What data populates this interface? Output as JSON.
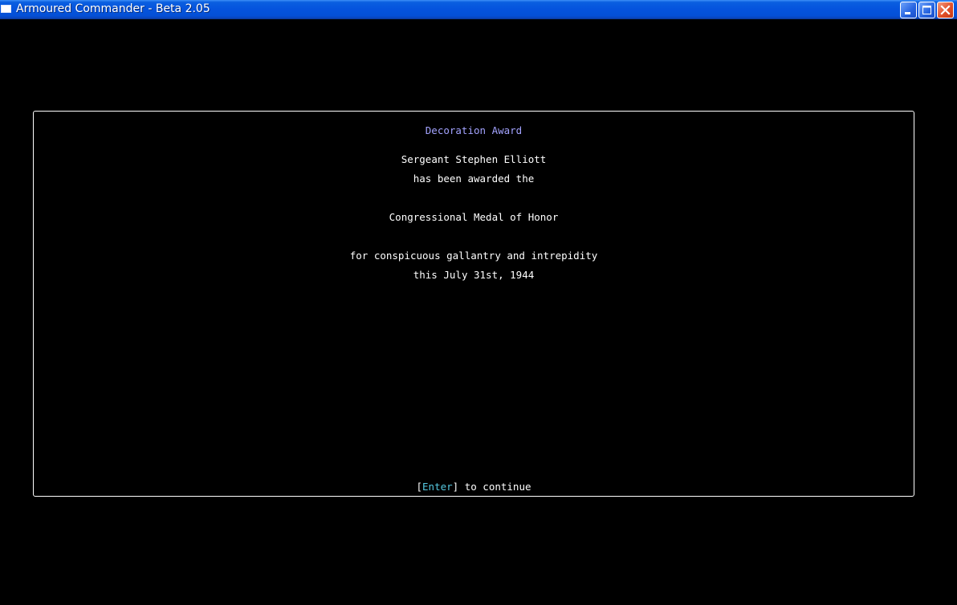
{
  "window": {
    "title": "Armoured Commander - Beta 2.05"
  },
  "dialog": {
    "heading": "Decoration Award",
    "recipient": "Sergeant Stephen Elliott",
    "awarded_line": "has been awarded the",
    "medal": "Congressional Medal of Honor",
    "citation": "for conspicuous gallantry and intrepidity",
    "date_line": "this July 31st, 1944",
    "prompt": {
      "open_bracket": "[",
      "key": "Enter",
      "close_bracket": "]",
      "text": " to continue"
    }
  },
  "colors": {
    "background": "#000000",
    "text": "#ffffff",
    "heading": "#a3a3ff",
    "key_highlight": "#55c8e0"
  },
  "icons": {
    "minimize": "minimize-icon",
    "maximize": "maximize-icon",
    "close": "close-icon"
  }
}
